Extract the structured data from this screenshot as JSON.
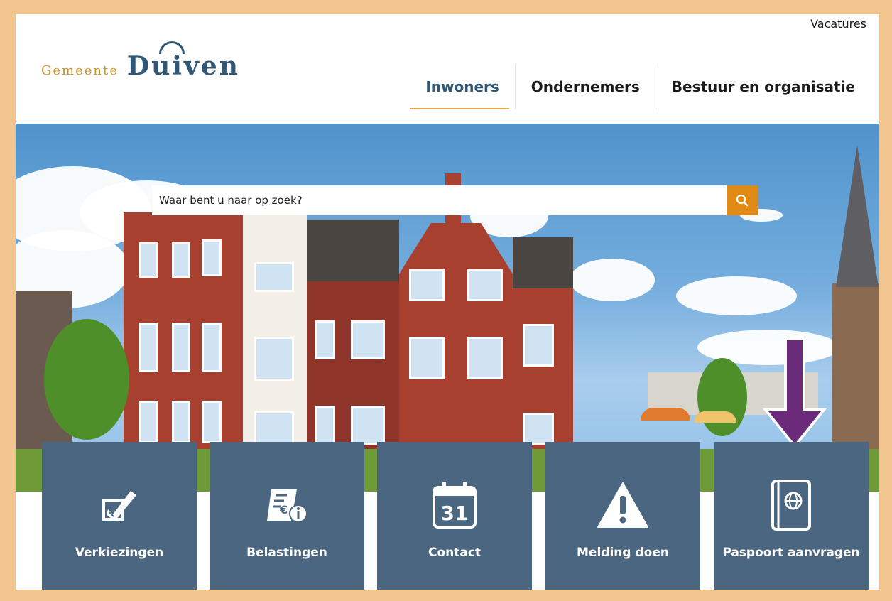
{
  "header": {
    "top_link": "Vacatures",
    "logo_small": "Gemeente",
    "logo_big": "Duiven"
  },
  "nav": {
    "items": [
      {
        "label": "Inwoners",
        "active": true
      },
      {
        "label": "Ondernemers",
        "active": false
      },
      {
        "label": "Bestuur en organisatie",
        "active": false
      }
    ]
  },
  "search": {
    "placeholder": "Waar bent u naar op zoek?",
    "button_icon": "search-icon"
  },
  "tiles": [
    {
      "label": "Verkiezingen",
      "icon": "ballot-pen-icon"
    },
    {
      "label": "Belastingen",
      "icon": "tax-bill-icon"
    },
    {
      "label": "Contact",
      "icon": "calendar-31-icon",
      "icon_text": "31"
    },
    {
      "label": "Melding doen",
      "icon": "warning-icon"
    },
    {
      "label": "Paspoort aanvragen",
      "icon": "passport-icon"
    }
  ],
  "colors": {
    "frame": "#f3c58e",
    "tile": "#4a6680",
    "search_button": "#e08a16",
    "logo_blue": "#2f5878",
    "logo_gold": "#c8932a",
    "arrow": "#6b2a7a"
  }
}
